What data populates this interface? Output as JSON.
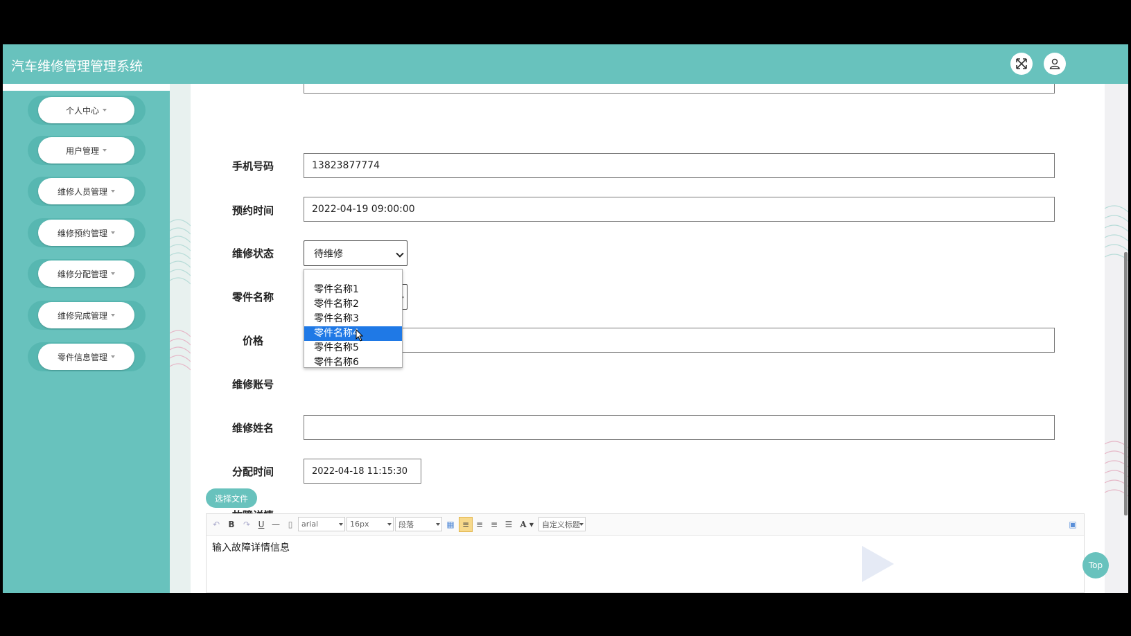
{
  "app": {
    "title": "汽车维修管理管理系统"
  },
  "colors": {
    "accent": "#68c2bd",
    "selected_option": "#1f79e6"
  },
  "header": {
    "fullscreen_icon": "expand-icon",
    "user_icon": "user-icon"
  },
  "sidebar": {
    "items": [
      {
        "label": "个人中心"
      },
      {
        "label": "用户管理"
      },
      {
        "label": "维修人员管理"
      },
      {
        "label": "维修预约管理"
      },
      {
        "label": "维修分配管理"
      },
      {
        "label": "维修完成管理"
      },
      {
        "label": "零件信息管理"
      }
    ]
  },
  "form": {
    "phone": {
      "label": "手机号码",
      "value": "13823877774"
    },
    "appointment_time": {
      "label": "预约时间",
      "value": "2022-04-19 09:00:00"
    },
    "repair_status": {
      "label": "维修状态",
      "value": "待维修"
    },
    "part_name": {
      "label": "零件名称",
      "value": "",
      "options": [
        "零件名称1",
        "零件名称2",
        "零件名称3",
        "零件名称4",
        "零件名称5",
        "零件名称6"
      ],
      "highlighted": "零件名称4"
    },
    "price": {
      "label": "价格",
      "value": ""
    },
    "repair_account": {
      "label": "维修账号",
      "value": ""
    },
    "repair_name": {
      "label": "维修姓名",
      "value": ""
    },
    "assign_time": {
      "label": "分配时间",
      "value": "2022-04-18 11:15:30"
    },
    "fault_details": {
      "label": "故障详情",
      "placeholder": "输入故障详情信息"
    }
  },
  "editor": {
    "file_button": "选择文件",
    "bold": "B",
    "underline": "U",
    "font_family": "arial",
    "font_size": "16px",
    "paragraph": "段落",
    "font_color": "A",
    "custom_title": "自定义标题"
  },
  "top_button": "Top"
}
